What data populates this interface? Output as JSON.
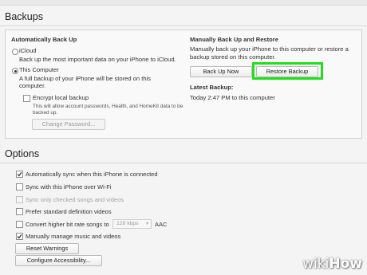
{
  "backups": {
    "title": "Backups",
    "auto": {
      "heading": "Automatically Back Up",
      "icloud_label": "iCloud",
      "icloud_desc": "Back up the most important data on your iPhone to iCloud.",
      "computer_label": "This Computer",
      "computer_desc_1": "A full backup of your iPhone will be stored on this",
      "computer_desc_2": "computer.",
      "encrypt_label": "Encrypt local backup",
      "encrypt_desc_1": "This will allow account passwords, Health, and HomeKit data to be",
      "encrypt_desc_2": "backed up.",
      "change_password": "Change Password..."
    },
    "manual": {
      "heading": "Manually Back Up and Restore",
      "desc_1": "Manually back up your iPhone to this computer or restore a",
      "desc_2": "backup stored on this computer.",
      "back_up_now": "Back Up Now",
      "restore_backup": "Restore Backup",
      "latest_heading": "Latest Backup:",
      "latest_value": "Today 2:47 PM to this computer"
    }
  },
  "options": {
    "title": "Options",
    "items": [
      {
        "label": "Automatically sync when this iPhone is connected",
        "checked": true,
        "disabled": false
      },
      {
        "label": "Sync with this iPhone over Wi-Fi",
        "checked": false,
        "disabled": false
      },
      {
        "label": "Sync only checked songs and videos",
        "checked": false,
        "disabled": true
      },
      {
        "label": "Prefer standard definition videos",
        "checked": false,
        "disabled": false
      },
      {
        "label": "Convert higher bit rate songs to",
        "checked": false,
        "disabled": false
      },
      {
        "label": "Manually manage music and videos",
        "checked": true,
        "disabled": false
      }
    ],
    "bitrate_value": "128 kbps",
    "bitrate_suffix": "AAC",
    "reset_warnings": "Reset Warnings",
    "configure_accessibility": "Configure Accessibility..."
  },
  "watermark": {
    "wiki": "wiki",
    "how": "How"
  },
  "colors": {
    "highlight": "#1fe01a"
  }
}
